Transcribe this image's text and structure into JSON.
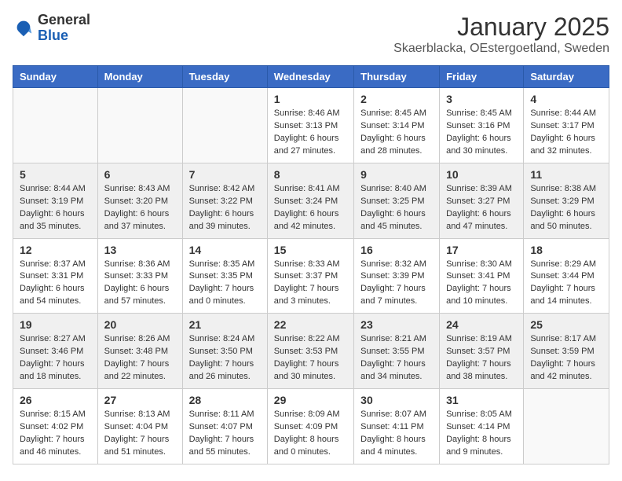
{
  "logo": {
    "general": "General",
    "blue": "Blue"
  },
  "title": "January 2025",
  "subtitle": "Skaerblacka, OEstergoetland, Sweden",
  "days_of_week": [
    "Sunday",
    "Monday",
    "Tuesday",
    "Wednesday",
    "Thursday",
    "Friday",
    "Saturday"
  ],
  "weeks": [
    [
      {
        "day": "",
        "info": ""
      },
      {
        "day": "",
        "info": ""
      },
      {
        "day": "",
        "info": ""
      },
      {
        "day": "1",
        "info": "Sunrise: 8:46 AM\nSunset: 3:13 PM\nDaylight: 6 hours and 27 minutes."
      },
      {
        "day": "2",
        "info": "Sunrise: 8:45 AM\nSunset: 3:14 PM\nDaylight: 6 hours and 28 minutes."
      },
      {
        "day": "3",
        "info": "Sunrise: 8:45 AM\nSunset: 3:16 PM\nDaylight: 6 hours and 30 minutes."
      },
      {
        "day": "4",
        "info": "Sunrise: 8:44 AM\nSunset: 3:17 PM\nDaylight: 6 hours and 32 minutes."
      }
    ],
    [
      {
        "day": "5",
        "info": "Sunrise: 8:44 AM\nSunset: 3:19 PM\nDaylight: 6 hours and 35 minutes."
      },
      {
        "day": "6",
        "info": "Sunrise: 8:43 AM\nSunset: 3:20 PM\nDaylight: 6 hours and 37 minutes."
      },
      {
        "day": "7",
        "info": "Sunrise: 8:42 AM\nSunset: 3:22 PM\nDaylight: 6 hours and 39 minutes."
      },
      {
        "day": "8",
        "info": "Sunrise: 8:41 AM\nSunset: 3:24 PM\nDaylight: 6 hours and 42 minutes."
      },
      {
        "day": "9",
        "info": "Sunrise: 8:40 AM\nSunset: 3:25 PM\nDaylight: 6 hours and 45 minutes."
      },
      {
        "day": "10",
        "info": "Sunrise: 8:39 AM\nSunset: 3:27 PM\nDaylight: 6 hours and 47 minutes."
      },
      {
        "day": "11",
        "info": "Sunrise: 8:38 AM\nSunset: 3:29 PM\nDaylight: 6 hours and 50 minutes."
      }
    ],
    [
      {
        "day": "12",
        "info": "Sunrise: 8:37 AM\nSunset: 3:31 PM\nDaylight: 6 hours and 54 minutes."
      },
      {
        "day": "13",
        "info": "Sunrise: 8:36 AM\nSunset: 3:33 PM\nDaylight: 6 hours and 57 minutes."
      },
      {
        "day": "14",
        "info": "Sunrise: 8:35 AM\nSunset: 3:35 PM\nDaylight: 7 hours and 0 minutes."
      },
      {
        "day": "15",
        "info": "Sunrise: 8:33 AM\nSunset: 3:37 PM\nDaylight: 7 hours and 3 minutes."
      },
      {
        "day": "16",
        "info": "Sunrise: 8:32 AM\nSunset: 3:39 PM\nDaylight: 7 hours and 7 minutes."
      },
      {
        "day": "17",
        "info": "Sunrise: 8:30 AM\nSunset: 3:41 PM\nDaylight: 7 hours and 10 minutes."
      },
      {
        "day": "18",
        "info": "Sunrise: 8:29 AM\nSunset: 3:44 PM\nDaylight: 7 hours and 14 minutes."
      }
    ],
    [
      {
        "day": "19",
        "info": "Sunrise: 8:27 AM\nSunset: 3:46 PM\nDaylight: 7 hours and 18 minutes."
      },
      {
        "day": "20",
        "info": "Sunrise: 8:26 AM\nSunset: 3:48 PM\nDaylight: 7 hours and 22 minutes."
      },
      {
        "day": "21",
        "info": "Sunrise: 8:24 AM\nSunset: 3:50 PM\nDaylight: 7 hours and 26 minutes."
      },
      {
        "day": "22",
        "info": "Sunrise: 8:22 AM\nSunset: 3:53 PM\nDaylight: 7 hours and 30 minutes."
      },
      {
        "day": "23",
        "info": "Sunrise: 8:21 AM\nSunset: 3:55 PM\nDaylight: 7 hours and 34 minutes."
      },
      {
        "day": "24",
        "info": "Sunrise: 8:19 AM\nSunset: 3:57 PM\nDaylight: 7 hours and 38 minutes."
      },
      {
        "day": "25",
        "info": "Sunrise: 8:17 AM\nSunset: 3:59 PM\nDaylight: 7 hours and 42 minutes."
      }
    ],
    [
      {
        "day": "26",
        "info": "Sunrise: 8:15 AM\nSunset: 4:02 PM\nDaylight: 7 hours and 46 minutes."
      },
      {
        "day": "27",
        "info": "Sunrise: 8:13 AM\nSunset: 4:04 PM\nDaylight: 7 hours and 51 minutes."
      },
      {
        "day": "28",
        "info": "Sunrise: 8:11 AM\nSunset: 4:07 PM\nDaylight: 7 hours and 55 minutes."
      },
      {
        "day": "29",
        "info": "Sunrise: 8:09 AM\nSunset: 4:09 PM\nDaylight: 8 hours and 0 minutes."
      },
      {
        "day": "30",
        "info": "Sunrise: 8:07 AM\nSunset: 4:11 PM\nDaylight: 8 hours and 4 minutes."
      },
      {
        "day": "31",
        "info": "Sunrise: 8:05 AM\nSunset: 4:14 PM\nDaylight: 8 hours and 9 minutes."
      },
      {
        "day": "",
        "info": ""
      }
    ]
  ]
}
